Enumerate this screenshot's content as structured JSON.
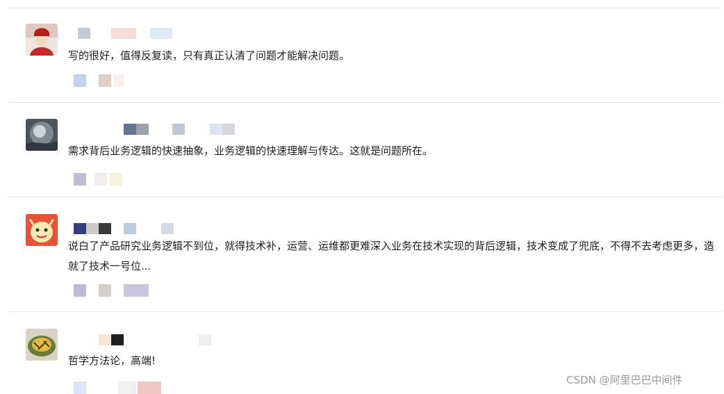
{
  "comments": [
    {
      "text": "写的很好，值得反复读，只有真正认清了问题才能解决问题。",
      "avatar": {
        "bg": "#c62828",
        "accent": "#f4d6c0"
      },
      "name_blocks": [
        "#9aa7b8",
        "#f6dcd6",
        "#dfe9f4"
      ],
      "action_blocks": [
        "#c3d3ee",
        "#dcd0c6",
        "#f7eeee"
      ]
    },
    {
      "text": "需求背后业务逻辑的快速抽象，业务逻辑的快速理解与传达。这就是问题所在。",
      "avatar": {
        "bg": "#5e6b72",
        "accent": "#dfe6ea"
      },
      "name_blocks": [
        "#62748f",
        "#9aa0a8",
        "#c2c6d2",
        "#d9e3f3",
        "#b8bcc4"
      ],
      "action_blocks": [
        "#c0bed6",
        "#f3eeee",
        "#f8f1dc"
      ]
    },
    {
      "text": "说白了产品研究业务逻辑不到位，就得技术补，运营、运维都更难深入业务在技术实现的背后逻辑，技术变成了兜底，不得不去考虑更多，造就了技术一号位...",
      "avatar": {
        "bg": "#e8523a",
        "accent": "#f7e9b0"
      },
      "name_blocks": [
        "#353d7a",
        "#c9c9d3",
        "#3a3a3a",
        "#bccbe0",
        "#d5dae3"
      ],
      "action_blocks": [
        "#bcbad4",
        "#d4cfca",
        "#c9c5dc"
      ]
    },
    {
      "text": "哲学方法论，高端!",
      "avatar": {
        "bg": "#6a7a3a",
        "accent": "#e7b83c"
      },
      "name_blocks": [
        "#f7e3d3",
        "#1f1f1f",
        "#eeeeee"
      ],
      "action_blocks": [
        "#dbe5f4",
        "#f0f0f0",
        "#efc8c4"
      ]
    }
  ],
  "watermark": "CSDN @阿里巴巴中间件"
}
